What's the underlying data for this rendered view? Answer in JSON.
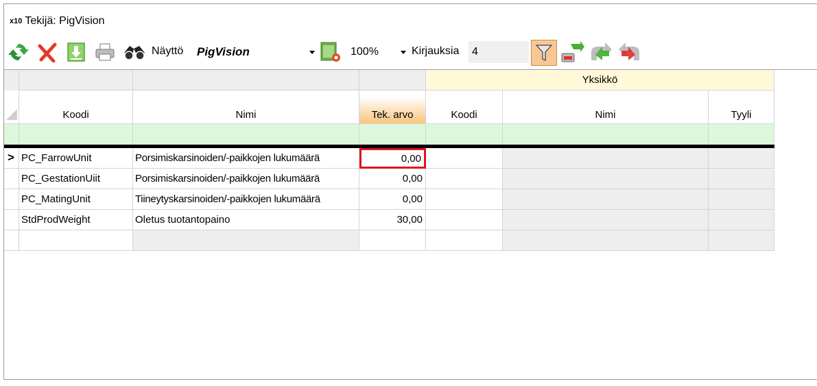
{
  "window": {
    "badge": "x10",
    "title": "Tekijä: PigVision"
  },
  "toolbar": {
    "icons": [
      "refresh-icon",
      "delete-icon",
      "save-download-icon",
      "print-icon",
      "binoculars-icon",
      "settings-report-icon",
      "filter-icon",
      "export-icon",
      "forward-icon",
      "back-icon"
    ],
    "view_label": "Näyttö",
    "view_value": "PigVision",
    "zoom_value": "100%",
    "records_label": "Kirjauksia",
    "records_value": "4"
  },
  "grid": {
    "group_header": "Yksikkö",
    "columns": [
      "Koodi",
      "Nimi",
      "Tek. arvo",
      "Koodi",
      "Nimi",
      "Tyyli"
    ],
    "current_row_marker": ">",
    "rows": [
      {
        "code": "PC_FarrowUnit",
        "name": "Porsimiskarsinoiden/-paikkojen lukumäärä",
        "value": "0,00"
      },
      {
        "code": "PC_GestationUiit",
        "name": "Porsimiskarsinoiden/-paikkojen lukumäärä",
        "value": "0,00"
      },
      {
        "code": "PC_MatingUnit",
        "name": "Tiineytyskarsinoiden/-paikkojen lukumäärä",
        "value": "0,00"
      },
      {
        "code": "StdProdWeight",
        "name": "Oletus tuotantopaino",
        "value": "30,00"
      }
    ]
  },
  "colors": {
    "highlight_border": "#e0141e",
    "filter_row": "#ddf7dd",
    "group_header": "#fff9d9",
    "sorted_header": "#f9c47a"
  }
}
